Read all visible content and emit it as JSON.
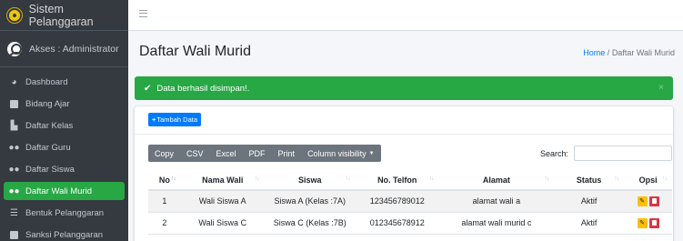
{
  "brand": {
    "title": "Sistem Pelanggaran",
    "logo_icon": "logo-icon"
  },
  "user": {
    "label": "Akses : Administrator",
    "icon": "user-circle-icon"
  },
  "sidebar": {
    "items": [
      {
        "label": "Dashboard",
        "icon": "dashboard-icon",
        "active": false
      },
      {
        "label": "Bidang Ajar",
        "icon": "book-icon",
        "active": false
      },
      {
        "label": "Daftar Kelas",
        "icon": "class-icon",
        "active": false
      },
      {
        "label": "Daftar Guru",
        "icon": "users-icon",
        "active": false
      },
      {
        "label": "Daftar Siswa",
        "icon": "users-icon",
        "active": false
      },
      {
        "label": "Daftar Wali Murid",
        "icon": "users-icon",
        "active": true
      },
      {
        "label": "Bentuk Pelanggaran",
        "icon": "list-icon",
        "active": false
      },
      {
        "label": "Sanksi Pelanggaran",
        "icon": "sanction-icon",
        "active": false
      }
    ]
  },
  "header": {
    "menu_icon": "hamburger-icon"
  },
  "page": {
    "title": "Daftar Wali Murid",
    "breadcrumb": {
      "home": "Home",
      "separator": "/",
      "current": "Daftar Wali Murid"
    }
  },
  "alert": {
    "message": "Data berhasil disimpan!.",
    "close": "×",
    "color": "#28a745"
  },
  "card": {
    "add_button": {
      "plus": "+",
      "label": "Tambah Data"
    },
    "toolbar": [
      "Copy",
      "CSV",
      "Excel",
      "PDF",
      "Print",
      "Column visibility"
    ],
    "search_label": "Search:",
    "search_value": ""
  },
  "table": {
    "columns": [
      "No",
      "Nama Wali",
      "Siswa",
      "No. Telfon",
      "Alamat",
      "Status",
      "Opsi"
    ],
    "rows": [
      {
        "no": "1",
        "nama": "Wali Siswa A",
        "siswa": "Siswa A (Kelas :7A)",
        "telfon": "123456789012",
        "alamat": "alamat wali a",
        "status": "Aktif"
      },
      {
        "no": "2",
        "nama": "Wali Siswa C",
        "siswa": "Siswa C (Kelas :7B)",
        "telfon": "012345678912",
        "alamat": "alamat wali murid c",
        "status": "Aktif"
      }
    ]
  },
  "colors": {
    "sidebar": "#343a40",
    "accent": "#28a745",
    "primary": "#007bff",
    "toolbar": "#6c757d",
    "edit": "#ffc107",
    "delete": "#dc3545"
  }
}
